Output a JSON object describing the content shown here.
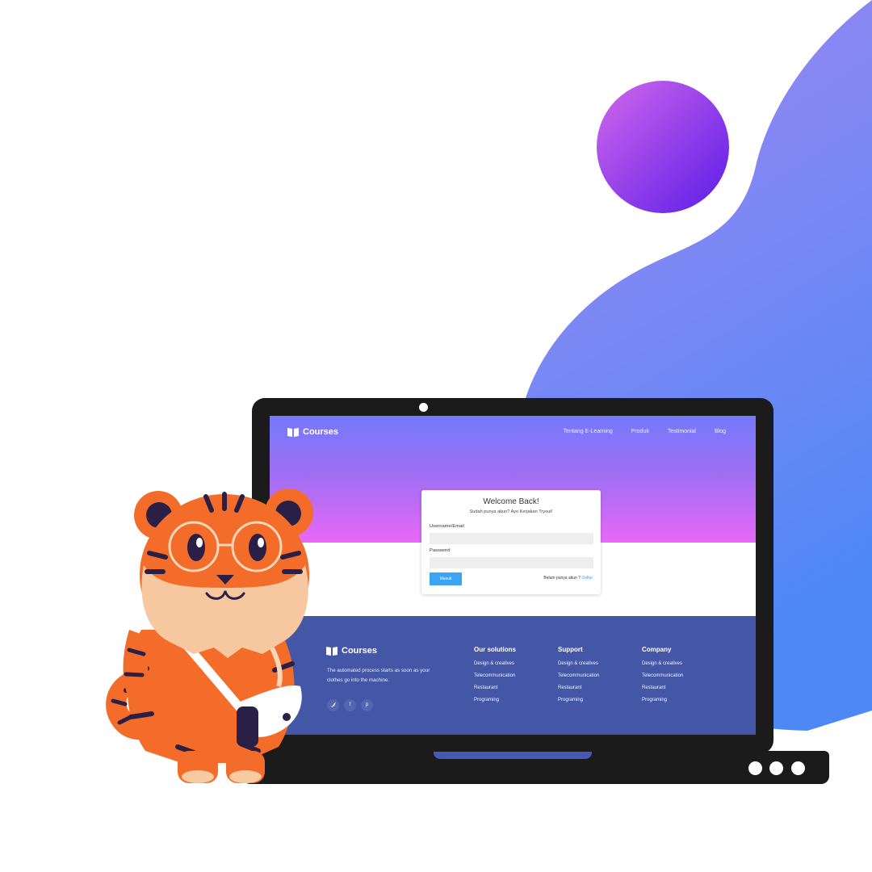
{
  "colors": {
    "blob_top": "#a287f1",
    "blob_bottom": "#4e88f7",
    "circle_light": "#c962ec",
    "circle_dark": "#5b1fe8",
    "hero_top": "#7479fa",
    "hero_bottom": "#e968f7",
    "footer_bg": "#4457a6",
    "button_blue": "#3da3f5",
    "tiger_orange": "#f46c2a"
  },
  "nav": {
    "logo_icon": "open-book-icon",
    "logo_text": "Courses",
    "links": [
      "Tentang E-Learning",
      "Produk",
      "Testimonial",
      "Blog"
    ]
  },
  "login": {
    "title": "Welcome Back!",
    "subtitle": "Sudah punya akun? Ayo Kerjakan Tryout!",
    "username_label": "Username/Email",
    "password_label": "Password",
    "button_label": "Masuk",
    "register_prompt": "Belum punya akun ?",
    "register_link": "Daftar"
  },
  "footer": {
    "logo_text": "Courses",
    "description": "The automated process starts as soon as your clothes go into the machine.",
    "social_icons": [
      "twitter-icon",
      "facebook-icon",
      "pinterest-icon"
    ],
    "columns": [
      {
        "title": "Our solutions",
        "items": [
          "Design & creatives",
          "Telecommunication",
          "Restaurant",
          "Programing"
        ]
      },
      {
        "title": "Support",
        "items": [
          "Design & creatives",
          "Telecommunication",
          "Restaurant",
          "Programing"
        ]
      },
      {
        "title": "Company",
        "items": [
          "Design & creatives",
          "Telecommunication",
          "Restaurant",
          "Programing"
        ]
      }
    ]
  }
}
